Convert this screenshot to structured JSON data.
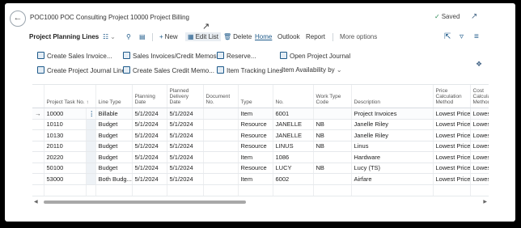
{
  "header": {
    "title": "POC1000 POC Consulting Project 10000 Project Billing",
    "saved_label": "Saved"
  },
  "tabbar": {
    "page_name": "Project Planning Lines",
    "new_label": "New",
    "edit_list_label": "Edit List",
    "delete_label": "Delete",
    "home_label": "Home",
    "outlook_label": "Outlook",
    "report_label": "Report",
    "more_label": "More options"
  },
  "actions": {
    "create_sales_invoice": "Create Sales Invoice...",
    "sales_invoices_credit_memos": "Sales Invoices/Credit Memos...",
    "reserve": "Reserve...",
    "open_project_journal": "Open Project Journal",
    "create_project_journal_lines": "Create Project Journal Lines",
    "create_sales_credit_memo": "Create Sales Credit Memo...",
    "item_tracking_lines": "Item Tracking Lines",
    "item_availability_by": "Item Availability by"
  },
  "table": {
    "columns": [
      "Project Task No. ↑",
      "Line Type",
      "Planning Date",
      "Planned Delivery Date",
      "Document No.",
      "Type",
      "No.",
      "Work Type Code",
      "Description",
      "Price Calculation Method",
      "Cost Calculation Method"
    ],
    "rows": [
      {
        "task": "10000",
        "line_type": "Billable",
        "planning": "5/1/2024",
        "delivery": "5/1/2024",
        "doc": "",
        "type": "Item",
        "no": "6001",
        "work": "",
        "desc": "Project Invoices",
        "price": "Lowest Price",
        "cost": "Lowest Price"
      },
      {
        "task": "10110",
        "line_type": "Budget",
        "planning": "5/1/2024",
        "delivery": "5/1/2024",
        "doc": "",
        "type": "Resource",
        "no": "JANELLE",
        "work": "NB",
        "desc": "Janelle Riley",
        "price": "Lowest Price",
        "cost": "Lowest Price"
      },
      {
        "task": "10130",
        "line_type": "Budget",
        "planning": "5/1/2024",
        "delivery": "5/1/2024",
        "doc": "",
        "type": "Resource",
        "no": "JANELLE",
        "work": "NB",
        "desc": "Janelle Riley",
        "price": "Lowest Price",
        "cost": "Lowest Price"
      },
      {
        "task": "20110",
        "line_type": "Budget",
        "planning": "5/1/2024",
        "delivery": "5/1/2024",
        "doc": "",
        "type": "Resource",
        "no": "LINUS",
        "work": "NB",
        "desc": "Linus",
        "price": "Lowest Price",
        "cost": "Lowest Price"
      },
      {
        "task": "20220",
        "line_type": "Budget",
        "planning": "5/1/2024",
        "delivery": "5/1/2024",
        "doc": "",
        "type": "Item",
        "no": "1086",
        "work": "",
        "desc": "Hardware",
        "price": "Lowest Price",
        "cost": "Lowest Price"
      },
      {
        "task": "50100",
        "line_type": "Budget",
        "planning": "5/1/2024",
        "delivery": "5/1/2024",
        "doc": "",
        "type": "Resource",
        "no": "LUCY",
        "work": "NB",
        "desc": "Lucy (TS)",
        "price": "Lowest Price",
        "cost": "Lowest Price"
      },
      {
        "task": "53000",
        "line_type": "Both Budg...",
        "planning": "5/1/2024",
        "delivery": "5/1/2024",
        "doc": "",
        "type": "Item",
        "no": "6002",
        "work": "",
        "desc": "Airfare",
        "price": "Lowest Price",
        "cost": "Lowest Price"
      }
    ]
  }
}
